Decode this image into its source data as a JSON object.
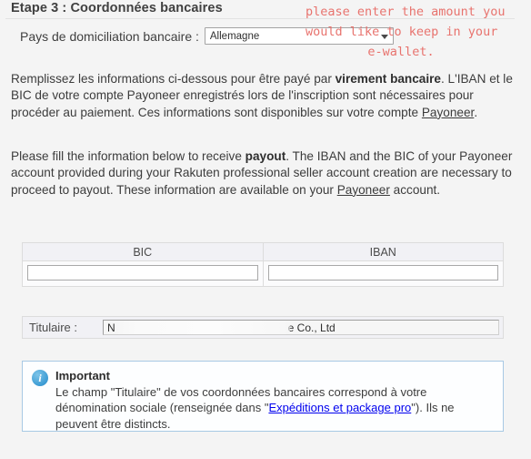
{
  "page": {
    "title": "Etape 3 : Coordonnées bancaires",
    "background_color": "#f4f4f4"
  },
  "country_field": {
    "label": "Pays de domiciliation bancaire :",
    "selected_value": "Allemagne",
    "dropdown_icon": "chevron-down-icon"
  },
  "annotation": {
    "color": "#e8736e",
    "line1": "please enter the amount you",
    "line2": "would like to keep in your",
    "line3": "e-wallet."
  },
  "paragraph_fr": {
    "part1": "Remplissez les informations ci-dessous pour être payé par ",
    "bold1": "virement bancaire",
    "part2": ". L'IBAN et le BIC de votre compte Payoneer enregistrés lors de l'inscription sont nécessaires pour procéder au paiement. Ces informations sont disponibles sur votre compte ",
    "link": "Payoneer",
    "part3": "."
  },
  "paragraph_en": {
    "part1": "Please fill the information below to receive ",
    "bold1": "payout",
    "part2": ". The IBAN and the BIC of your Payoneer account provided during your Rakuten professional seller account creation are necessary to proceed to payout. These information are available on your ",
    "link": "Payoneer",
    "part3": " account."
  },
  "bank_table": {
    "headers": [
      "BIC",
      "IBAN"
    ],
    "bic_value": "",
    "iban_value": "",
    "bic_placeholder": "",
    "iban_placeholder": ""
  },
  "titulaire": {
    "label": "Titulaire :",
    "value_prefix": "N",
    "value_suffix": "e Co., Ltd",
    "redacted": "true"
  },
  "info_box": {
    "icon": "info-icon",
    "title": "Important",
    "line1": "Le champ \"Titulaire\" de vos coordonnées bancaires correspond à votre",
    "line2_pre": "dénomination sociale (renseignée dans \"",
    "line2_link": "Expéditions et package pro",
    "line2_post": "\").",
    "line3": "Ils ne peuvent être distincts.",
    "border_color": "#a8c9e4",
    "accent_color": "#3d9cd4"
  }
}
